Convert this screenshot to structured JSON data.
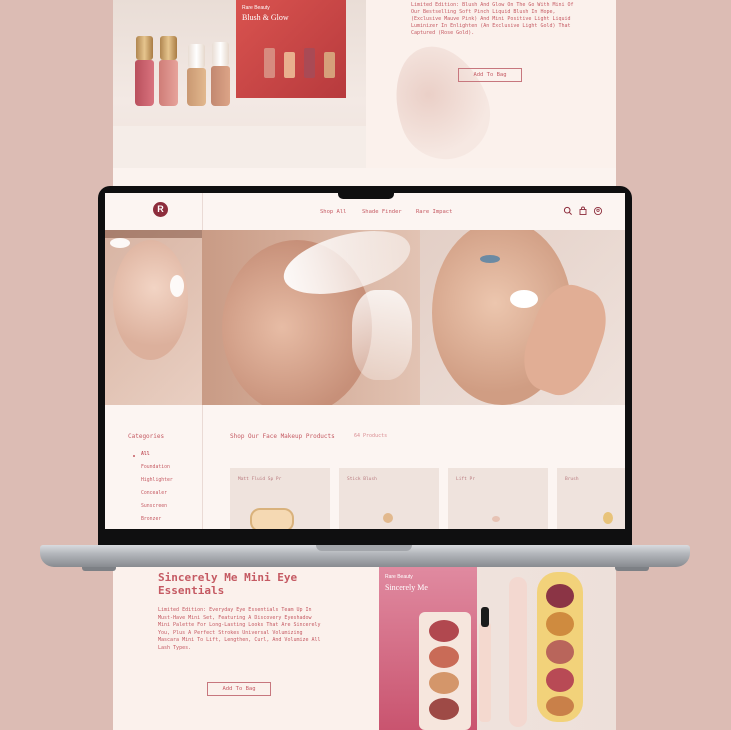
{
  "top_section": {
    "box_brand": "Rare Beauty",
    "box_title": "Blush & Glow",
    "promo_text": "Limited Edition: Blush And Glow On The Go With Mini Of Our Bestselling Soft Pinch Liquid Blush In Hope, (Exclusive Mauve Pink) And Mini Positive Light Liquid Luminizer In Enlighten (An Exclusive Light Gold) That Captured (Rose Gold).",
    "add_button": "Add To Bag"
  },
  "site": {
    "nav": {
      "logo": "R",
      "links": [
        "Shop All",
        "Shade Finder",
        "Rare Impact"
      ],
      "icons": [
        "search-icon",
        "bag-icon",
        "account-icon"
      ]
    },
    "sidebar": {
      "title": "Categories",
      "items": [
        {
          "label": "All",
          "active": true
        },
        {
          "label": "Foundation",
          "active": false
        },
        {
          "label": "Highlighter",
          "active": false
        },
        {
          "label": "Concealer",
          "active": false
        },
        {
          "label": "Sunscreen",
          "active": false
        },
        {
          "label": "Bronzer",
          "active": false
        }
      ]
    },
    "main": {
      "title": "Shop Our Face Makeup Products",
      "count": "64 Products",
      "cards": [
        "Matt Fluid Sp Pr",
        "Stick Blush",
        "Lift Pr",
        "Brush"
      ]
    }
  },
  "bottom_section": {
    "title": "Sincerely Me Mini Eye Essentials",
    "body": "Limited Edition: Everyday Eye Essentials Team Up In Must-Have Mini Set, Featuring A Discovery Eyeshadow Mini Palette For Long-Lasting Looks That Are Sincerely You, Plus A Perfect Strokes Universal Volumizing Mascara Mini To Lift, Lengthen, Curl, And Volumize All Lash Types.",
    "add_button": "Add To Bag",
    "box_brand": "Rare Beauty",
    "box_title": "Sincerely Me"
  },
  "colors": {
    "background": "#dcbcb4",
    "accent": "#c55a63",
    "logo": "#8d2d3c",
    "page": "#fbf3ef"
  }
}
